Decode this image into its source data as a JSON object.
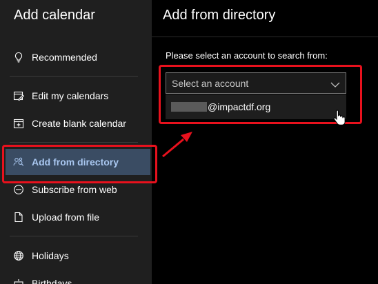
{
  "sidebar": {
    "title": "Add calendar",
    "items": [
      {
        "label": "Recommended",
        "icon": "lightbulb-icon"
      },
      {
        "label": "Edit my calendars",
        "icon": "edit-calendar-icon"
      },
      {
        "label": "Create blank calendar",
        "icon": "calendar-add-icon"
      },
      {
        "label": "Add from directory",
        "icon": "people-search-icon",
        "selected": true
      },
      {
        "label": "Subscribe from web",
        "icon": "web-icon"
      },
      {
        "label": "Upload from file",
        "icon": "file-upload-icon"
      },
      {
        "label": "Holidays",
        "icon": "globe-icon"
      },
      {
        "label": "Birthdays",
        "icon": "birthday-icon"
      }
    ]
  },
  "main": {
    "title": "Add from directory",
    "prompt": "Please select an account to search from:",
    "select": {
      "placeholder": "Select an account",
      "icon": "chevron-down-icon"
    },
    "dropdown": {
      "options": [
        {
          "label": "@impactdf.org",
          "redacted_prefix": true
        }
      ]
    }
  },
  "annotations": {
    "highlight_color": "#e8111d",
    "cursor": "hand-pointer-icon"
  },
  "colors": {
    "sidebar_bg": "#1f1f1f",
    "main_bg": "#000000",
    "selected_bg": "#3a4c63",
    "selected_text": "#a9c7f0"
  }
}
